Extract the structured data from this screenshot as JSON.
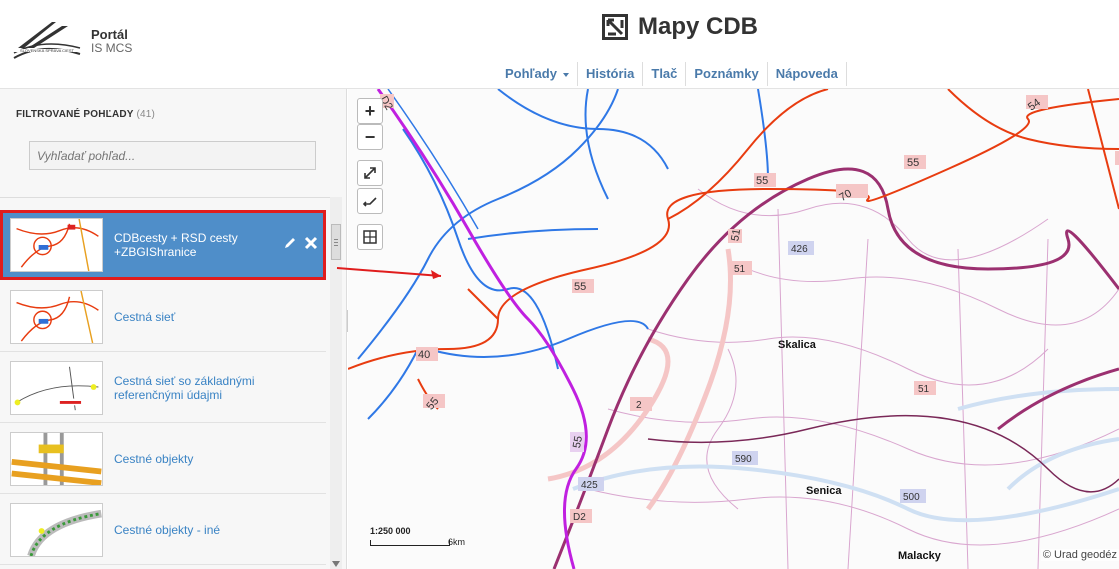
{
  "header": {
    "portal_title": "Portál",
    "portal_subtitle": "IS MCS",
    "logo_text": "SLOVENSKÁ SPRÁVA CIEST",
    "app_title": "Mapy CDB",
    "nav": [
      {
        "label": "Pohľady",
        "has_caret": true
      },
      {
        "label": "História"
      },
      {
        "label": "Tlač"
      },
      {
        "label": "Poznámky"
      },
      {
        "label": "Nápoveda"
      }
    ]
  },
  "sidebar": {
    "title": "FILTROVANÉ POHĽADY",
    "count": "(41)",
    "search_placeholder": "Vyhľadať pohľad...",
    "items": [
      {
        "label": "CDBcesty + RSD cesty +ZBGIShranice",
        "active": true
      },
      {
        "label": "Cestná sieť"
      },
      {
        "label": "Cestná sieť so základnými referenčnými údajmi"
      },
      {
        "label": "Cestné objekty"
      },
      {
        "label": "Cestné objekty - iné"
      }
    ]
  },
  "map": {
    "scale": "1:250 000",
    "scale_unit": "6km",
    "copyright": "© Urad geodéz",
    "places": [
      "Skalica",
      "Senica",
      "Malacky"
    ],
    "road_labels": [
      "D2",
      "55",
      "40",
      "55",
      "54",
      "55",
      "55",
      "70",
      "71",
      "51",
      "426",
      "51",
      "2",
      "51",
      "590",
      "425",
      "D2",
      "500"
    ],
    "colors": {
      "motorway": "#c020e0",
      "road": "#e83c10",
      "river": "#2f78e6",
      "border": "#9b3070"
    }
  }
}
